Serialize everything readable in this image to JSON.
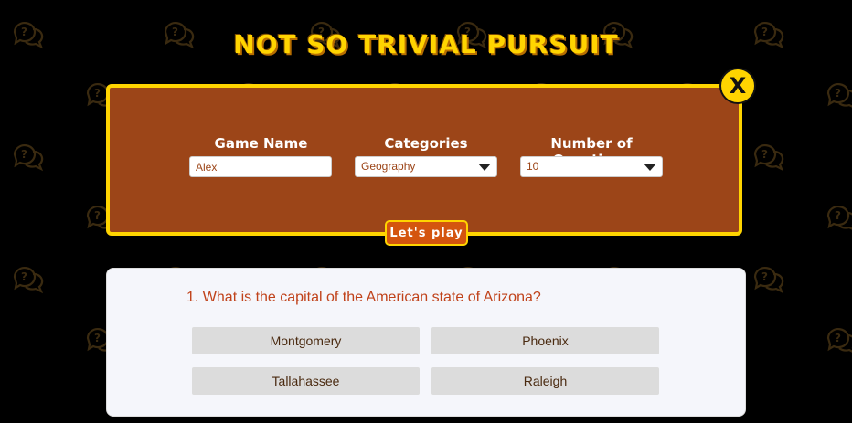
{
  "app": {
    "title": "NOT SO TRIVIAL PURSUIT",
    "background_icon": "question-bubble-icon",
    "colors": {
      "accent": "#ffd400",
      "panel": "#9c4518",
      "button": "#d4550f",
      "question_text": "#c0421a"
    }
  },
  "setup": {
    "close_label": "X",
    "game_name": {
      "label": "Game Name",
      "value": "Alex"
    },
    "categories": {
      "label": "Categories",
      "selected": "Geography"
    },
    "num_questions": {
      "label": "Number of Questions",
      "selected": "10"
    },
    "play_label": "Let's play"
  },
  "question": {
    "text": "1. What is the capital of the American state of Arizona?",
    "answers": [
      "Montgomery",
      "Phoenix",
      "Tallahassee",
      "Raleigh"
    ]
  }
}
